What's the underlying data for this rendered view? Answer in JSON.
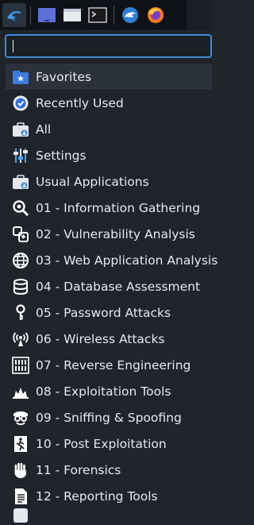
{
  "taskbar": {
    "icons": [
      "kali-menu-icon",
      "workspace-icon",
      "file-manager-icon",
      "terminal-icon",
      "kali-browser-icon",
      "firefox-icon"
    ]
  },
  "search": {
    "value": "",
    "placeholder": ""
  },
  "menu": {
    "items": [
      {
        "label": "Favorites",
        "icon": "favorites-icon"
      },
      {
        "label": "Recently Used",
        "icon": "recently-used-icon"
      },
      {
        "label": "All",
        "icon": "all-apps-icon"
      },
      {
        "label": "Settings",
        "icon": "settings-icon"
      },
      {
        "label": "Usual Applications",
        "icon": "usual-apps-icon"
      },
      {
        "label": "01 - Information Gathering",
        "icon": "magnifier-icon"
      },
      {
        "label": "02 - Vulnerability Analysis",
        "icon": "vuln-icon"
      },
      {
        "label": "03 - Web Application Analysis",
        "icon": "globe-icon"
      },
      {
        "label": "04 - Database Assessment",
        "icon": "database-icon"
      },
      {
        "label": "05 - Password Attacks",
        "icon": "key-icon"
      },
      {
        "label": "06 - Wireless Attacks",
        "icon": "wireless-icon"
      },
      {
        "label": "07 - Reverse Engineering",
        "icon": "binary-icon"
      },
      {
        "label": "08 - Exploitation Tools",
        "icon": "exploit-icon"
      },
      {
        "label": "09 - Sniffing & Spoofing",
        "icon": "sniffing-icon"
      },
      {
        "label": "10 - Post Exploitation",
        "icon": "post-exploit-icon"
      },
      {
        "label": "11 - Forensics",
        "icon": "hand-icon"
      },
      {
        "label": "12 - Reporting Tools",
        "icon": "report-icon"
      }
    ]
  },
  "colors": {
    "accent": "#3d8bd9",
    "background": "#20242b",
    "selected": "#2c323c"
  }
}
